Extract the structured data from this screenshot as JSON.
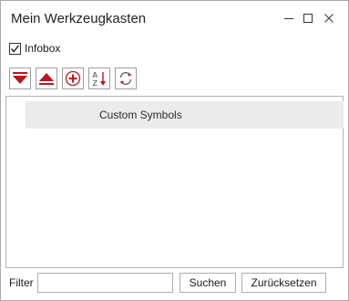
{
  "window": {
    "title": "Mein Werkzeugkasten",
    "controls": [
      "minimize-icon",
      "maximize-icon",
      "close-icon"
    ]
  },
  "infobox": {
    "label": "Infobox",
    "checked": true
  },
  "toolbar": {
    "buttons": [
      {
        "icon": "collapse-down-icon"
      },
      {
        "icon": "expand-up-icon"
      },
      {
        "icon": "add-circle-icon"
      },
      {
        "icon": "sort-az-icon"
      },
      {
        "icon": "refresh-icon"
      }
    ],
    "accent": "#c0141e"
  },
  "list": {
    "items": [
      {
        "label": "Custom Symbols",
        "selected": true
      }
    ]
  },
  "filter": {
    "label": "Filter",
    "value": "",
    "search_label": "Suchen",
    "reset_label": "Zurücksetzen"
  }
}
